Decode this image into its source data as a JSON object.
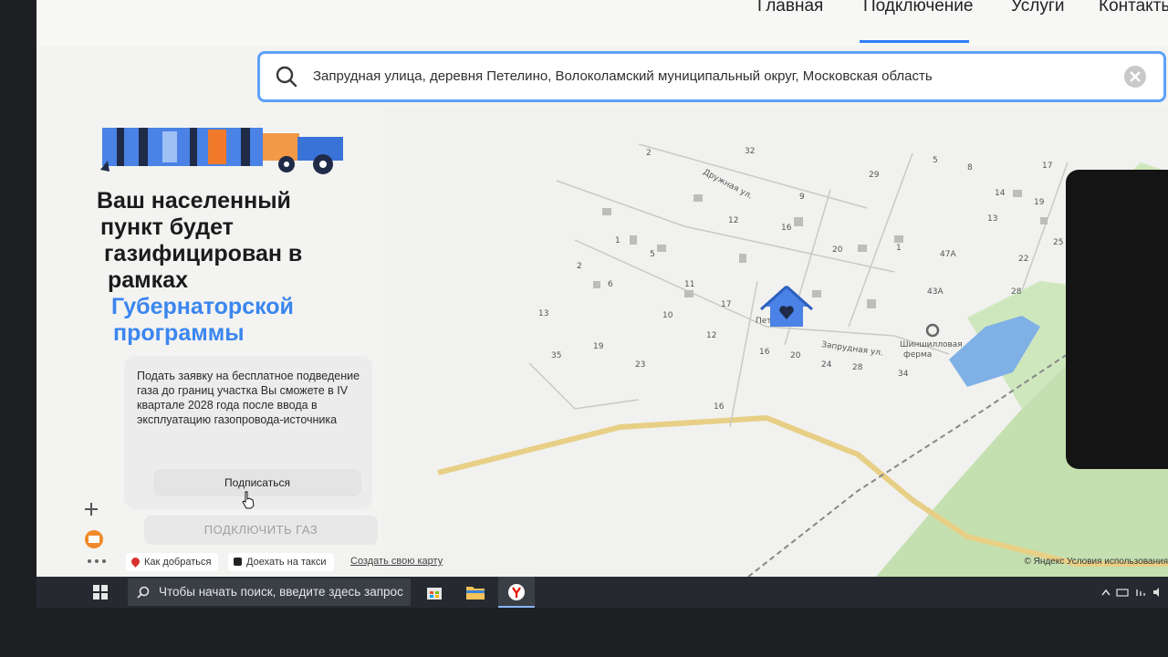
{
  "nav": {
    "items": [
      "Главная",
      "Подключение",
      "Услуги",
      "Контакты"
    ]
  },
  "search": {
    "value": "Запрудная улица, деревня Петелино, Волоколамский муниципальный округ, Московская область"
  },
  "promo": {
    "headline_lines": [
      "Ваш населенный",
      "пункт будет",
      "газифицирован в",
      "рамках"
    ],
    "headline_blue_lines": [
      "Губернаторской",
      "программы"
    ],
    "info_text": "Подать заявку на бесплатное подведение газа до границ участка Вы сможете в IV квартале 2028 года после ввода в эксплуатацию газопровода-источника",
    "subscribe_label": "Подписаться",
    "connect_label": "ПОДКЛЮЧИТЬ ГАЗ"
  },
  "map": {
    "street_labels": [
      "Дружная ул.",
      "Запрудная ул."
    ],
    "poi_label_lines": [
      "Шиншилловая",
      "ферма"
    ],
    "village_label": "Петелино",
    "house_numbers": [
      "2",
      "32",
      "29",
      "5",
      "8",
      "17",
      "14",
      "19",
      "23",
      "9",
      "12",
      "16",
      "20",
      "1",
      "47А",
      "13",
      "22",
      "25",
      "1",
      "5",
      "2",
      "6",
      "11",
      "17",
      "10",
      "13",
      "12",
      "16",
      "20",
      "19",
      "35",
      "23",
      "16",
      "24",
      "28",
      "34",
      "43А",
      "28"
    ],
    "bottom_links": [
      "Как добраться",
      "Доехать на такси",
      "Создать свою карту"
    ],
    "copyright": "© Яндекс Условия использования"
  },
  "taskbar": {
    "search_placeholder": "Чтобы начать поиск, введите здесь запрос"
  },
  "colors": {
    "accent": "#3b86f0",
    "search_border": "#5ea2f8",
    "road": "#e8cf86",
    "water": "#7fb0e6",
    "park": "#c4e0b0"
  }
}
